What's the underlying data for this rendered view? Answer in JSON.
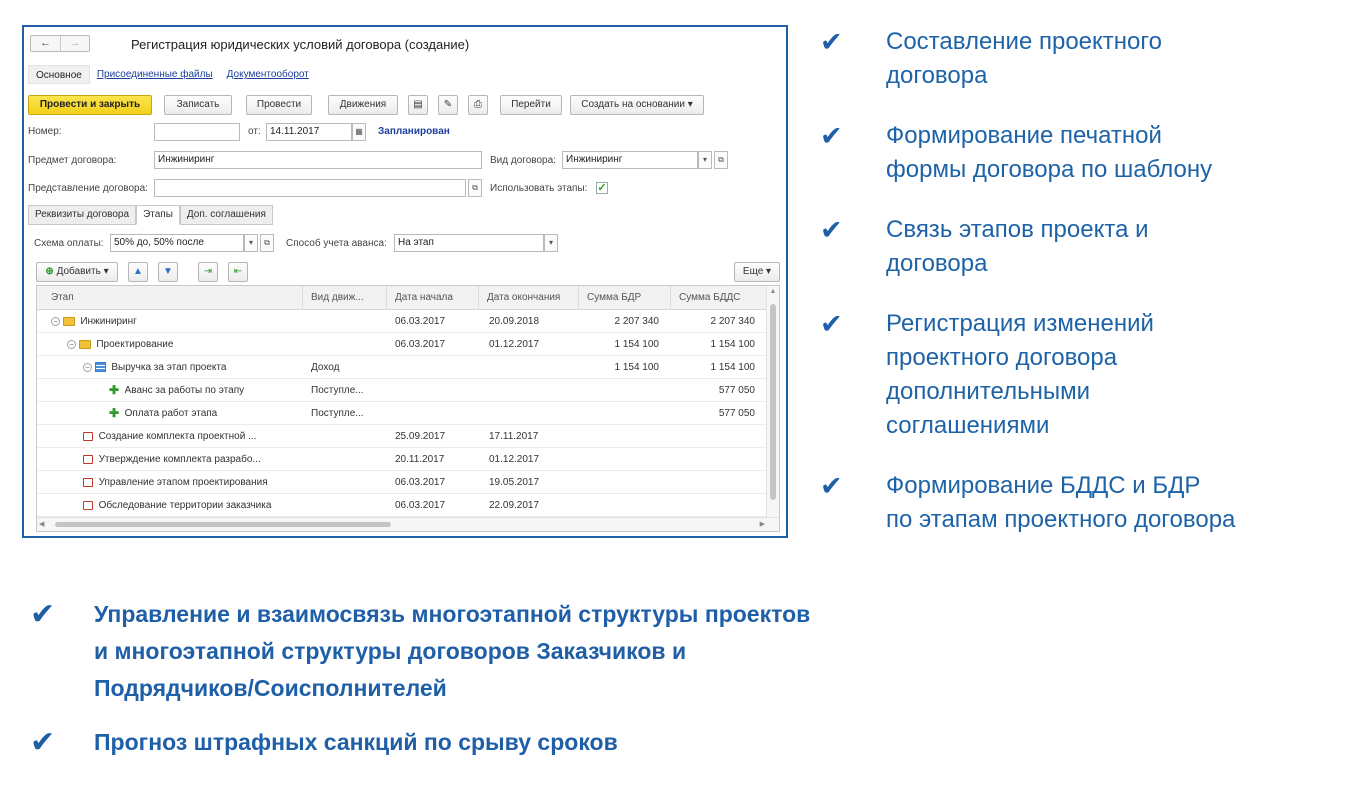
{
  "window": {
    "back": "←",
    "forward": "→",
    "title": "Регистрация юридических условий договора (создание)"
  },
  "tabs": [
    "Основное",
    "Присоединенные файлы",
    "Документооборот"
  ],
  "toolbar": {
    "post_close": "Провести и закрыть",
    "save": "Записать",
    "post": "Провести",
    "movements": "Движения",
    "goto": "Перейти",
    "create_based": "Создать на основании"
  },
  "form": {
    "number_label": "Номер:",
    "number_value": "",
    "date_label": "от:",
    "date_value": "14.11.2017",
    "status": "Запланирован",
    "subject_label": "Предмет договора:",
    "subject_value": "Инжиниринг",
    "kind_label": "Вид договора:",
    "kind_value": "Инжиниринг",
    "presentation_label": "Представление договора:",
    "presentation_value": "",
    "use_stages_label": "Использовать этапы:",
    "use_stages_checked": "✓"
  },
  "subtabs": [
    "Реквизиты договора",
    "Этапы",
    "Доп. соглашения"
  ],
  "payment": {
    "scheme_label": "Схема оплаты:",
    "scheme_value": "50% до, 50% после",
    "advance_label": "Способ учета аванса:",
    "advance_value": "На этап"
  },
  "gridbar": {
    "add": "Добавить",
    "more": "Еще"
  },
  "grid": {
    "columns": [
      "Этап",
      "Вид движ...",
      "Дата начала",
      "Дата окончания",
      "Сумма БДР",
      "Сумма БДДС"
    ],
    "rows": [
      {
        "stage": "Инжиниринг",
        "kind": "",
        "start": "06.03.2017",
        "end": "20.09.2018",
        "bdr": "2 207 340",
        "bdds": "2 207 340",
        "icon": "folder-icon",
        "level": 0
      },
      {
        "stage": "Проектирование",
        "kind": "",
        "start": "06.03.2017",
        "end": "01.12.2017",
        "bdr": "1 154 100",
        "bdds": "1 154 100",
        "icon": "folder-icon",
        "level": 1
      },
      {
        "stage": "Выручка за этап проекта",
        "kind": "Доход",
        "start": "",
        "end": "",
        "bdr": "1 154 100",
        "bdds": "1 154 100",
        "icon": "list-icon",
        "level": 2
      },
      {
        "stage": "Аванс за работы по этапу",
        "kind": "Поступле...",
        "start": "",
        "end": "",
        "bdr": "",
        "bdds": "577 050",
        "icon": "add-item-icon",
        "level": 3
      },
      {
        "stage": "Оплата работ этапа",
        "kind": "Поступле...",
        "start": "",
        "end": "",
        "bdr": "",
        "bdds": "577 050",
        "icon": "add-item-icon",
        "level": 3
      },
      {
        "stage": "Создание комплекта проектной ...",
        "kind": "",
        "start": "25.09.2017",
        "end": "17.11.2017",
        "bdr": "",
        "bdds": "",
        "icon": "link-icon",
        "level": 2
      },
      {
        "stage": "Утверждение комплекта разрабо...",
        "kind": "",
        "start": "20.11.2017",
        "end": "01.12.2017",
        "bdr": "",
        "bdds": "",
        "icon": "link-icon",
        "level": 2
      },
      {
        "stage": "Управление этапом проектирования",
        "kind": "",
        "start": "06.03.2017",
        "end": "19.05.2017",
        "bdr": "",
        "bdds": "",
        "icon": "link-icon",
        "level": 2
      },
      {
        "stage": "Обследование территории заказчика",
        "kind": "",
        "start": "06.03.2017",
        "end": "22.09.2017",
        "bdr": "",
        "bdds": "",
        "icon": "link-icon",
        "level": 2
      }
    ]
  },
  "features": [
    {
      "check": "✔",
      "text": [
        "Составление проектного",
        "договора"
      ]
    },
    {
      "check": "✔",
      "text": [
        "Формирование печатной",
        "формы договора по шаблону"
      ]
    },
    {
      "check": "✔",
      "text": [
        "Связь этапов проекта и",
        "договора"
      ]
    },
    {
      "check": "✔",
      "text": [
        "Регистрация изменений",
        "проектного договора",
        "дополнительными",
        "соглашениями"
      ]
    },
    {
      "check": "✔",
      "text": [
        "Формирование БДДС и БДР",
        "по этапам проектного договора"
      ]
    }
  ],
  "bottom": [
    {
      "check": "✔",
      "text": [
        "Управление и взаимосвязь многоэтапной структуры проектов",
        "и многоэтапной структуры договоров Заказчиков и",
        "Подрядчиков/Соисполнителей"
      ]
    },
    {
      "check": "✔",
      "text": [
        "Прогноз штрафных санкций по срыву сроков"
      ]
    }
  ],
  "colors": {
    "accent": "#1f5fa8",
    "primary_button": "#f2cf1a",
    "status": "#1c3f9e"
  }
}
